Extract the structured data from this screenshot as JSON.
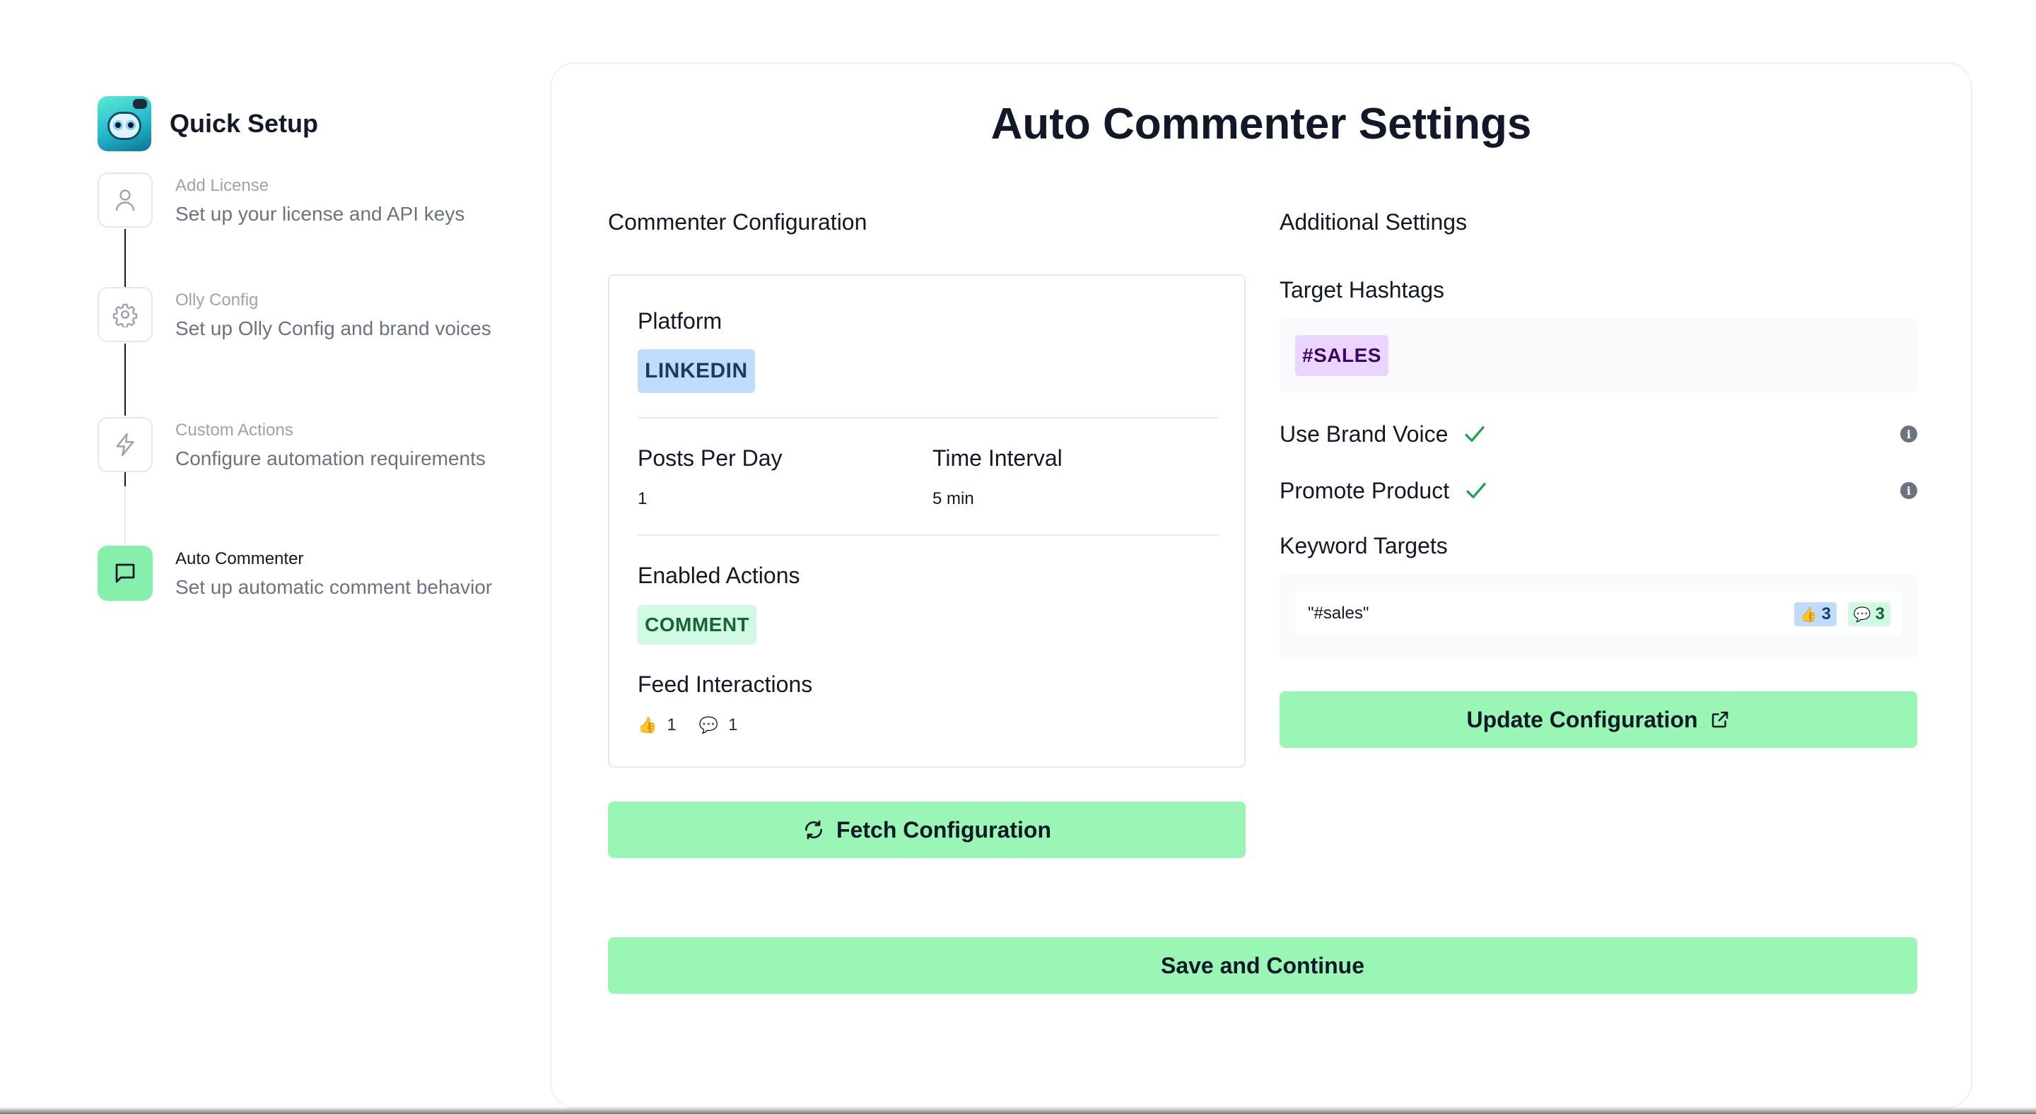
{
  "sidebar": {
    "title": "Quick Setup",
    "steps": [
      {
        "title": "Add License",
        "description": "Set up your license and API keys",
        "icon": "user-icon"
      },
      {
        "title": "Olly Config",
        "description": "Set up Olly Config and brand voices",
        "icon": "gear-icon"
      },
      {
        "title": "Custom Actions",
        "description": "Configure automation requirements",
        "icon": "lightning-icon"
      },
      {
        "title": "Auto Commenter",
        "description": "Set up automatic comment behavior",
        "icon": "message-icon"
      }
    ]
  },
  "main": {
    "title": "Auto Commenter Settings",
    "commenter": {
      "section_title": "Commenter Configuration",
      "platform_label": "Platform",
      "platform_value": "LINKEDIN",
      "posts_per_day_label": "Posts Per Day",
      "posts_per_day_value": "1",
      "time_interval_label": "Time Interval",
      "time_interval_value": "5 min",
      "enabled_actions_label": "Enabled Actions",
      "enabled_actions_value": "COMMENT",
      "feed_interactions_label": "Feed Interactions",
      "feed_likes": "1",
      "feed_comments": "1",
      "fetch_button": "Fetch Configuration"
    },
    "additional": {
      "section_title": "Additional Settings",
      "hashtags_label": "Target Hashtags",
      "hashtag": "#SALES",
      "brand_voice_label": "Use Brand Voice",
      "promote_product_label": "Promote Product",
      "keyword_targets_label": "Keyword Targets",
      "keyword": "\"#sales\"",
      "keyword_likes": "3",
      "keyword_comments": "3",
      "update_button": "Update Configuration"
    },
    "save_button": "Save and Continue"
  },
  "colors": {
    "accent_green": "#99f6b4",
    "platform_tag": "#bfdbfe",
    "action_tag": "#d1fae5",
    "hashtag_tag": "#e9d5ff",
    "check": "#16a34a"
  }
}
